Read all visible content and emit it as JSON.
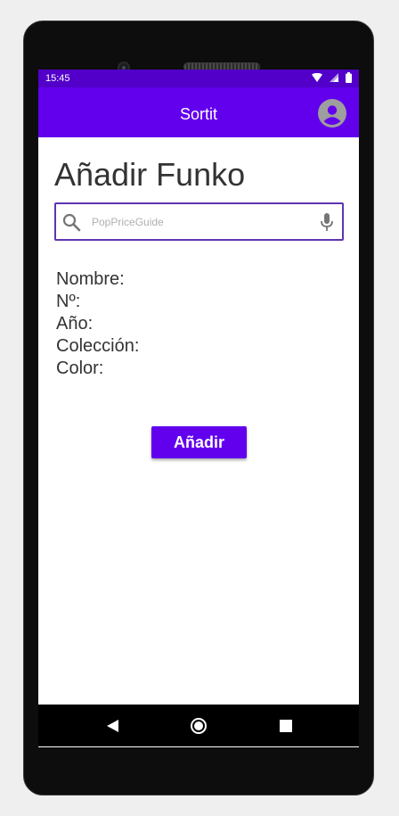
{
  "status_bar": {
    "time": "15:45",
    "icons": [
      "wifi-icon",
      "signal-icon",
      "battery-icon"
    ]
  },
  "app_bar": {
    "title": "Sortit",
    "avatar_icon": "account-circle-icon"
  },
  "page": {
    "heading": "Añadir Funko"
  },
  "search": {
    "placeholder": "PopPriceGuide",
    "value": "",
    "left_icon": "search-icon",
    "right_icon": "mic-icon"
  },
  "fields": {
    "nombre": "Nombre:",
    "numero": "Nº:",
    "anio": "Año:",
    "coleccion": "Colección:",
    "color": "Color:"
  },
  "actions": {
    "add_label": "Añadir"
  },
  "nav_bar": {
    "back_icon": "back-triangle-icon",
    "home_icon": "home-circle-icon",
    "recents_icon": "recents-square-icon"
  },
  "colors": {
    "primary": "#6200ee",
    "primary_dark": "#5200c9",
    "search_border": "#5e35b1",
    "text": "#333333"
  }
}
